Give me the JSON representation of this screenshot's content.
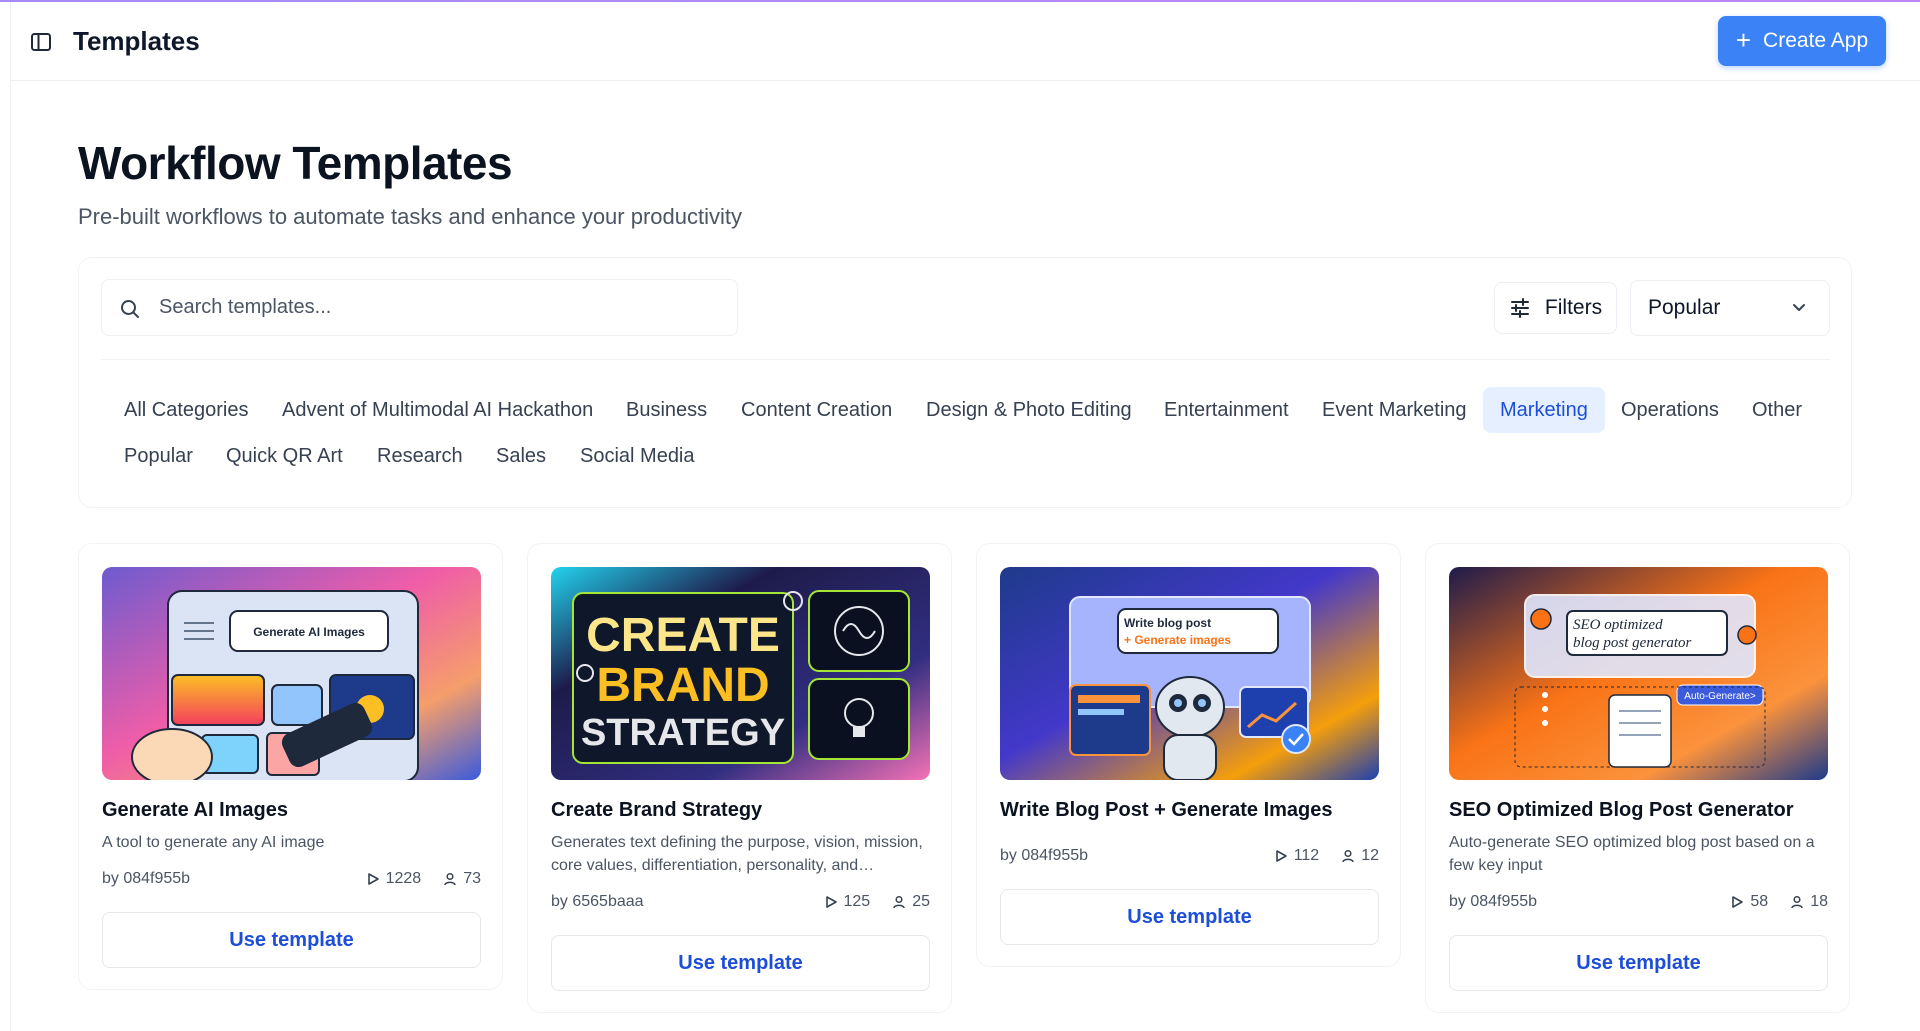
{
  "header": {
    "title": "Templates",
    "create_label": "Create App",
    "icons": {
      "sidebar_toggle": "sidebar-toggle-icon",
      "create": "plus-icon"
    }
  },
  "page": {
    "title": "Workflow Templates",
    "subtitle": "Pre-built workflows to automate tasks and enhance your productivity"
  },
  "search": {
    "placeholder": "Search templates...",
    "value": ""
  },
  "filters_label": "Filters",
  "sort": {
    "selected": "Popular"
  },
  "categories": [
    {
      "label": "All Categories",
      "active": false
    },
    {
      "label": "Advent of Multimodal AI Hackathon",
      "active": false
    },
    {
      "label": "Business",
      "active": false
    },
    {
      "label": "Content Creation",
      "active": false
    },
    {
      "label": "Design & Photo Editing",
      "active": false
    },
    {
      "label": "Entertainment",
      "active": false
    },
    {
      "label": "Event Marketing",
      "active": false
    },
    {
      "label": "Marketing",
      "active": true
    },
    {
      "label": "Operations",
      "active": false
    },
    {
      "label": "Other",
      "active": false
    },
    {
      "label": "Popular",
      "active": false
    },
    {
      "label": "Quick QR Art",
      "active": false
    },
    {
      "label": "Research",
      "active": false
    },
    {
      "label": "Sales",
      "active": false
    },
    {
      "label": "Social Media",
      "active": false
    }
  ],
  "cards": [
    {
      "title": "Generate AI Images",
      "description": "A tool to generate any AI image",
      "author": "by 084f955b",
      "runs": "1228",
      "users": "73",
      "button": "Use template",
      "thumb_text": "Generate AI Images"
    },
    {
      "title": "Create Brand Strategy",
      "description": "Generates text defining the purpose, vision, mission, core values, differentiation, personality, and positioning of a brand",
      "author": "by 6565baaa",
      "runs": "125",
      "users": "25",
      "button": "Use template",
      "thumb_text": [
        "CREATE",
        "BRAND",
        "STRATEGY"
      ]
    },
    {
      "title": "Write Blog Post + Generate Images",
      "description": "",
      "author": "by 084f955b",
      "runs": "112",
      "users": "12",
      "button": "Use template",
      "thumb_text": [
        "Write blog post",
        "+ Generate images"
      ]
    },
    {
      "title": "SEO Optimized Blog Post Generator",
      "description": "Auto-generate SEO optimized blog post based on a few key input",
      "author": "by 084f955b",
      "runs": "58",
      "users": "18",
      "button": "Use template",
      "thumb_text": [
        "SEO optimized",
        "blog post generator",
        "Auto-Generate>"
      ]
    }
  ],
  "colors": {
    "accent": "#3b82f6",
    "active_tab_bg": "#e6efff",
    "active_tab_text": "#1d4ed8",
    "link": "#1d4ed8"
  }
}
